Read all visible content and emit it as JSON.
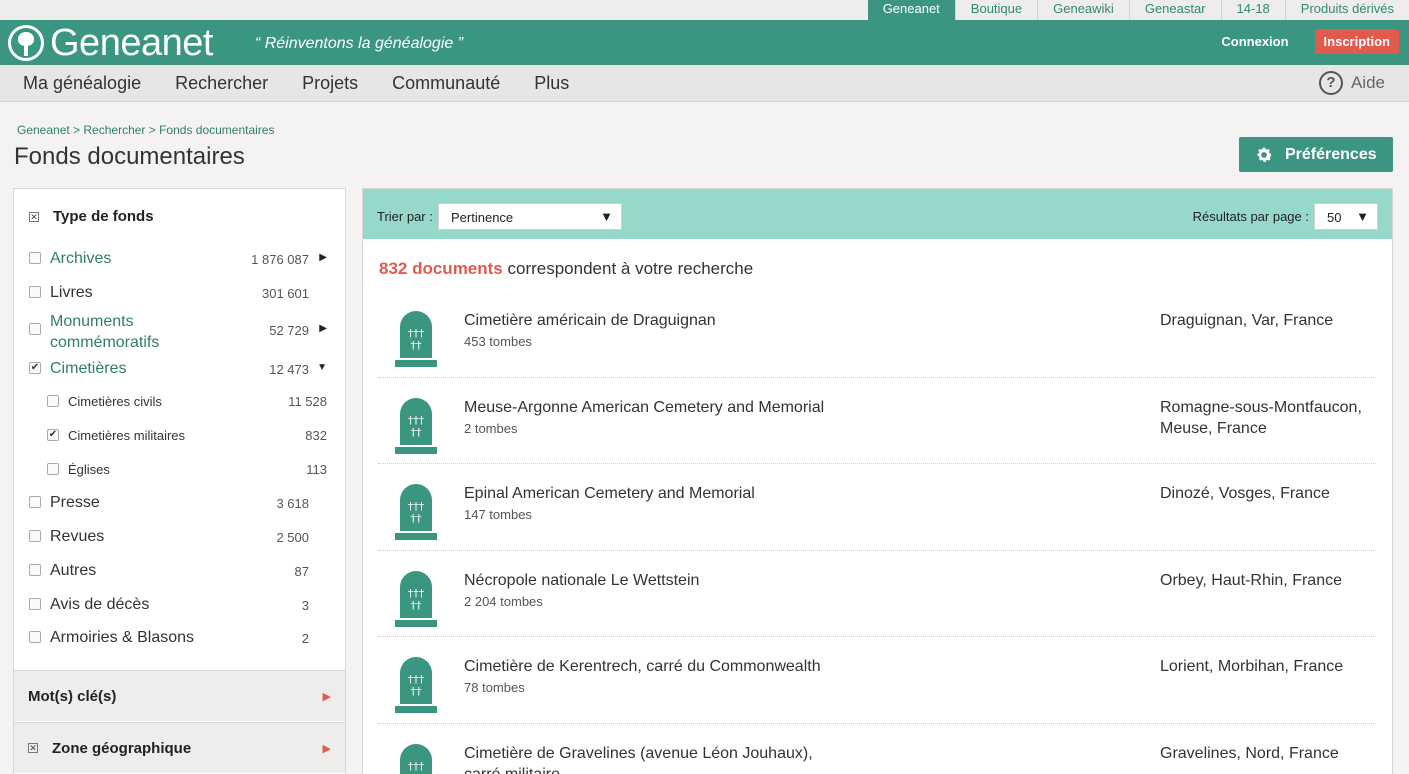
{
  "top_tabs": [
    "Geneanet",
    "Boutique",
    "Geneawiki",
    "Geneastar",
    "14-18",
    "Produits dérivés"
  ],
  "brand": {
    "name": "Geneanet",
    "tagline": "“ Réinventons la généalogie ”",
    "connexion": "Connexion",
    "inscription": "Inscription"
  },
  "nav": {
    "items": [
      "Ma généalogie",
      "Rechercher",
      "Projets",
      "Communauté",
      "Plus"
    ],
    "help_glyph": "?",
    "aide": "Aide"
  },
  "breadcrumb": "Geneanet > Rechercher > Fonds documentaires",
  "page_title": "Fonds documentaires",
  "preferences_button": "Préférences",
  "sidebar": {
    "type_heading": "Type de fonds",
    "items": [
      {
        "label": "Archives",
        "count": "1 876 087",
        "checked": false,
        "arrow": "right",
        "link": true
      },
      {
        "label": "Livres",
        "count": "301 601",
        "checked": false,
        "arrow": "",
        "link": false
      },
      {
        "label": "Monuments commémoratifs",
        "count": "52 729",
        "checked": false,
        "arrow": "right",
        "link": true
      },
      {
        "label": "Cimetières",
        "count": "12 473",
        "checked": true,
        "arrow": "down",
        "link": true
      },
      {
        "label": "Cimetières civils",
        "count": "11 528",
        "checked": false,
        "sub": true
      },
      {
        "label": "Cimetières militaires",
        "count": "832",
        "checked": true,
        "sub": true
      },
      {
        "label": "Églises",
        "count": "113",
        "checked": false,
        "sub": true
      },
      {
        "label": "Presse",
        "count": "3 618",
        "checked": false
      },
      {
        "label": "Revues",
        "count": "2 500",
        "checked": false
      },
      {
        "label": "Autres",
        "count": "87",
        "checked": false
      },
      {
        "label": "Avis de décès",
        "count": "3",
        "checked": false
      },
      {
        "label": "Armoiries & Blasons",
        "count": "2",
        "checked": false
      }
    ],
    "keywords_section": "Mot(s) clé(s)",
    "geo_section": "Zone géographique"
  },
  "results": {
    "sort_label": "Trier par :",
    "sort_value": "Pertinence",
    "per_page_label": "Résultats par page :",
    "per_page_value": "50",
    "count": "832 documents",
    "count_suffix": " correspondent à votre recherche",
    "rows": [
      {
        "title": "Cimetière américain de Draguignan",
        "sub": "453 tombes",
        "location": "Draguignan, Var, France"
      },
      {
        "title": "Meuse-Argonne American Cemetery and Memorial",
        "sub": "2 tombes",
        "location": "Romagne-sous-Montfaucon, Meuse, France"
      },
      {
        "title": "Epinal American Cemetery and Memorial",
        "sub": "147 tombes",
        "location": "Dinozé, Vosges, France"
      },
      {
        "title": "Nécropole nationale Le Wettstein",
        "sub": "2 204 tombes",
        "location": "Orbey, Haut-Rhin, France"
      },
      {
        "title": "Cimetière de Kerentrech, carré du Commonwealth",
        "sub": "78 tombes",
        "location": "Lorient, Morbihan, France"
      },
      {
        "title": "Cimetière de Gravelines (avenue Léon Jouhaux), carré militaire",
        "sub": "",
        "location": "Gravelines, Nord, France"
      }
    ]
  },
  "colors": {
    "accent": "#3a9680",
    "red": "#e05a4e",
    "sortbar": "#96d9cb"
  },
  "icons": [
    "tree-logo-icon",
    "help-icon",
    "gear-icon",
    "tombstone-icon",
    "checkbox-icon",
    "arrow-right-icon",
    "arrow-down-icon"
  ]
}
